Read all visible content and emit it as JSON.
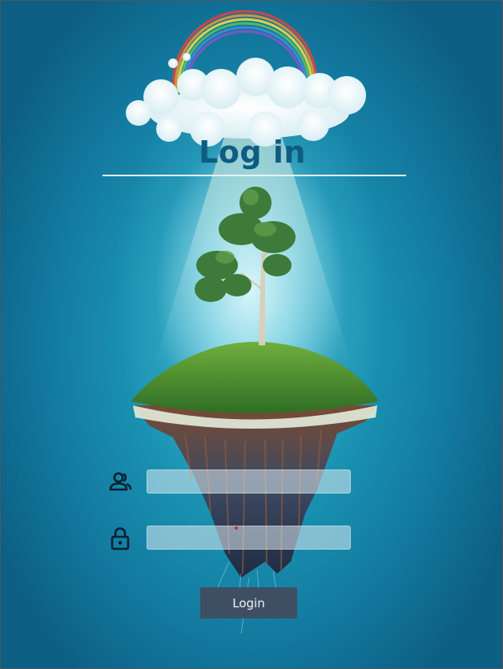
{
  "page": {
    "title": "Log in"
  },
  "form": {
    "username": {
      "icon": "users-icon",
      "value": "",
      "placeholder": ""
    },
    "password": {
      "icon": "lock-icon",
      "value": "",
      "placeholder": ""
    },
    "login_button_label": "Login"
  },
  "colors": {
    "background_outer": "#0d5f83",
    "background_inner": "#2fb0c8",
    "title": "#0f5c82",
    "button": "#3f4f63",
    "button_text": "#eef3f7"
  },
  "illustration": {
    "elements": [
      "rainbow",
      "cloud",
      "floating-island",
      "tree",
      "light-beam"
    ]
  }
}
